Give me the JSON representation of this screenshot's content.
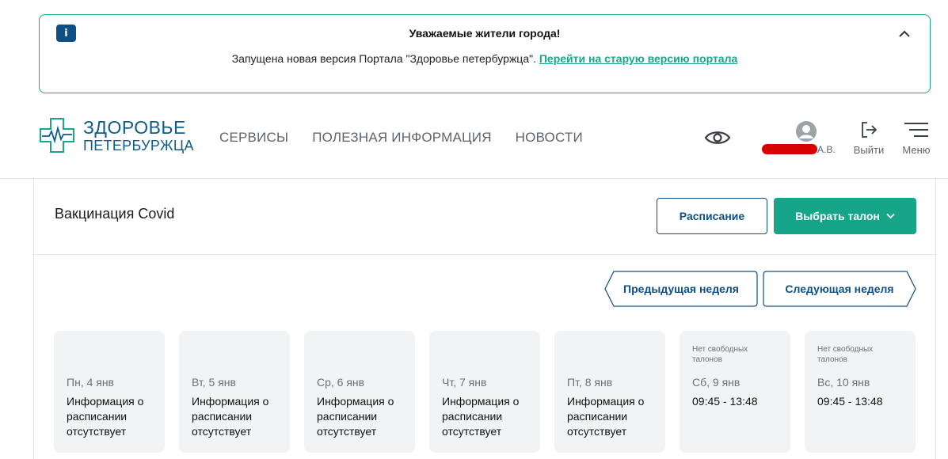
{
  "notice": {
    "info_glyph": "i",
    "title": "Уважаемые жители города!",
    "text": "Запущена новая версия Портала \"Здоровье петербуржца\".",
    "link": "Перейти на старую версию портала"
  },
  "logo": {
    "line1": "ЗДОРОВЬЕ",
    "line2": "ПЕТЕРБУРЖЦА"
  },
  "nav": [
    {
      "label": "СЕРВИСЫ"
    },
    {
      "label": "ПОЛЕЗНАЯ ИНФОРМАЦИЯ"
    },
    {
      "label": "НОВОСТИ"
    }
  ],
  "user": {
    "initials": "А.В."
  },
  "logout_label": "Выйти",
  "menu_label": "Меню",
  "page": {
    "title": "Вакцинация Covid",
    "schedule_button": "Расписание",
    "pick_button": "Выбрать талон",
    "prev_week": "Предыдущая неделя",
    "next_week": "Следующая неделя"
  },
  "days": [
    {
      "note": "",
      "date": "Пн, 4 янв",
      "info": "Информация о расписании отсутствует"
    },
    {
      "note": "",
      "date": "Вт, 5 янв",
      "info": "Информация о расписании отсутствует"
    },
    {
      "note": "",
      "date": "Ср, 6 янв",
      "info": "Информация о расписании отсутствует"
    },
    {
      "note": "",
      "date": "Чт, 7 янв",
      "info": "Информация о расписании отсутствует"
    },
    {
      "note": "",
      "date": "Пт, 8 янв",
      "info": "Информация о расписании отсутствует"
    },
    {
      "note": "Нет свободных талонов",
      "date": "Сб, 9 янв",
      "info": "09:45 - 13:48"
    },
    {
      "note": "Нет свободных талонов",
      "date": "Вс, 10 янв",
      "info": "09:45 - 13:48"
    }
  ],
  "colors": {
    "accent": "#17a58a",
    "brand_blue": "#0d4f86",
    "redaction": "#d60000"
  }
}
